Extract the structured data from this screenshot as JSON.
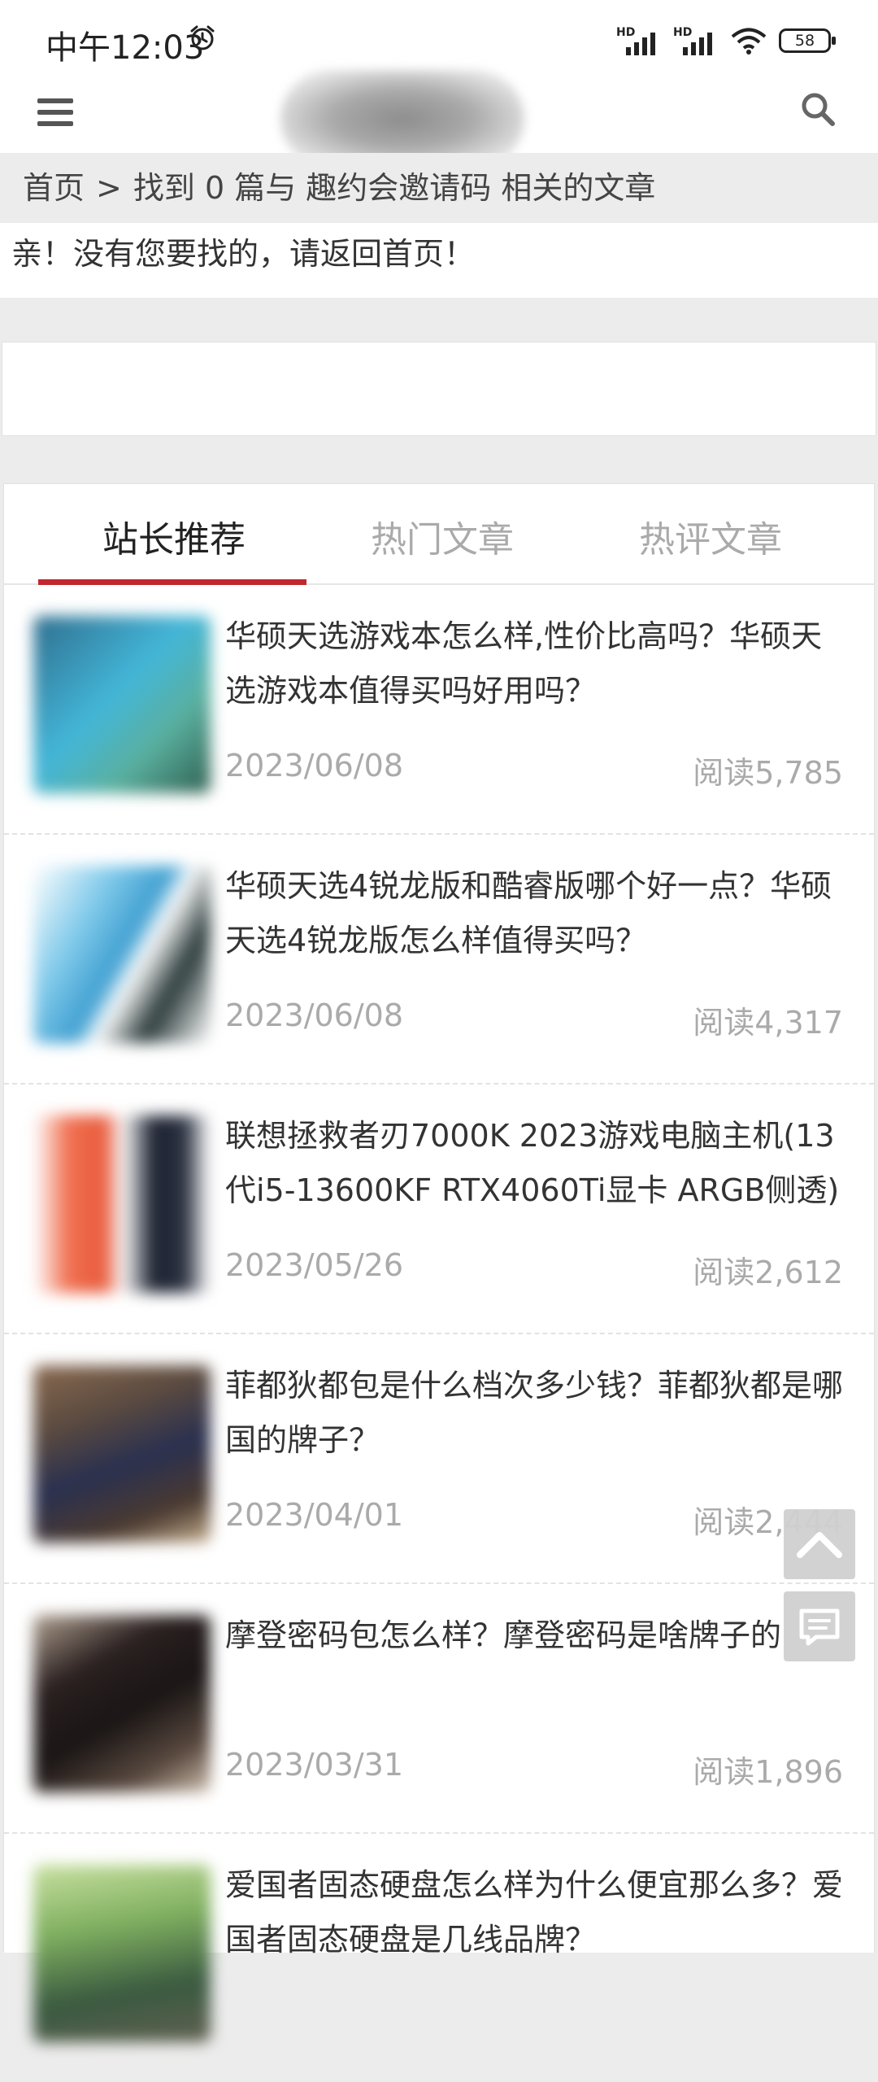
{
  "status_bar": {
    "time": "中午12:03",
    "battery": "58",
    "hd1": "HD",
    "hd2": "HD"
  },
  "header": {
    "menu_icon": "hamburger-menu-icon",
    "search_icon": "search-icon"
  },
  "breadcrumb": {
    "home": "首页",
    "sep": ">",
    "text": "找到 0 篇与 趣约会邀请码 相关的文章"
  },
  "notice": "亲！没有您要找的，请返回首页！",
  "tabs": [
    {
      "label": "站长推荐"
    },
    {
      "label": "热门文章"
    },
    {
      "label": "热评文章"
    }
  ],
  "articles": [
    {
      "title": "华硕天选游戏本怎么样,性价比高吗？华硕天选游戏本值得买吗好用吗？",
      "date": "2023/06/08",
      "reads": "阅读5,785"
    },
    {
      "title": "华硕天选4锐龙版和酷睿版哪个好一点？华硕天选4锐龙版怎么样值得买吗？",
      "date": "2023/06/08",
      "reads": "阅读4,317"
    },
    {
      "title": "联想拯救者刃7000K 2023游戏电脑主机(13代i5-13600KF RTX4060Ti显卡 ARGB侧透)",
      "date": "2023/05/26",
      "reads": "阅读2,612"
    },
    {
      "title": "菲都狄都包是什么档次多少钱？菲都狄都是哪国的牌子？",
      "date": "2023/04/01",
      "reads": "阅读2,444"
    },
    {
      "title": "摩登密码包怎么样？摩登密码是啥牌子的",
      "date": "2023/03/31",
      "reads": "阅读1,896"
    },
    {
      "title": "爱国者固态硬盘怎么样为什么便宜那么多？爱国者固态硬盘是几线品牌？",
      "date": "",
      "reads": ""
    }
  ],
  "colors": {
    "accent": "#c2272d",
    "muted": "#aaaaaa"
  }
}
